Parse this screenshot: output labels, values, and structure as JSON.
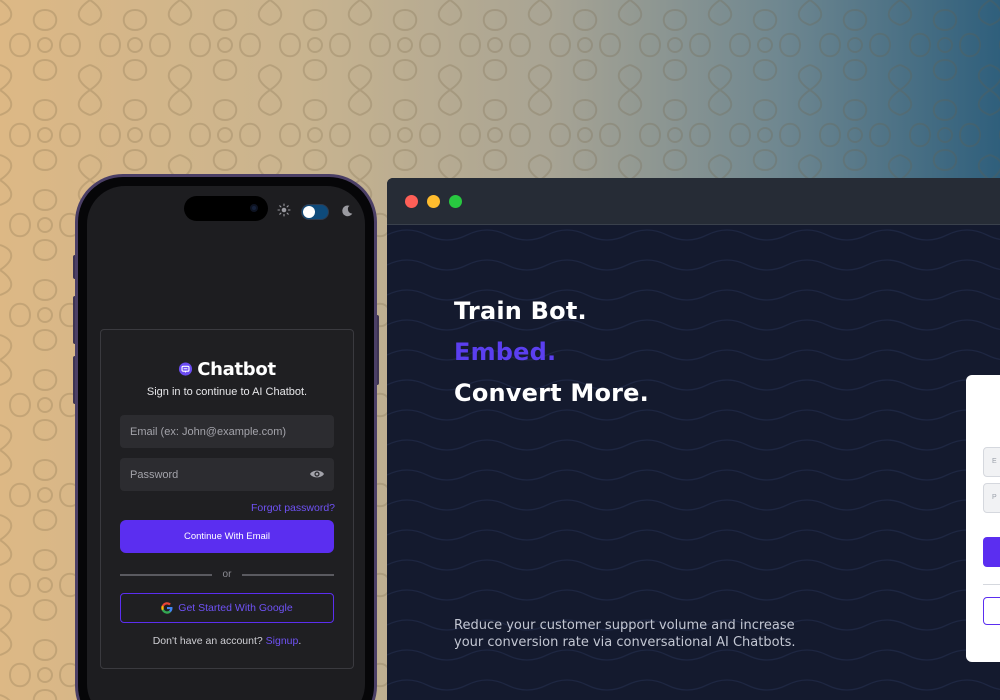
{
  "browser": {
    "hero": {
      "line1": "Train Bot.",
      "line2": "Embed.",
      "line3": "Convert More."
    },
    "tagline": "Reduce your customer support volume and increase your conversion rate via conversational AI Chatbots."
  },
  "phone": {
    "theme_toggle": {
      "state": "light",
      "icons": [
        "sun-icon",
        "moon-icon"
      ]
    },
    "login": {
      "brand": "Chatbot",
      "subtitle": "Sign in to continue to AI Chatbot.",
      "email_placeholder": "Email (ex: John@example.com)",
      "password_placeholder": "Password",
      "forgot_password": "Forgot password?",
      "continue_button": "Continue With Email",
      "or_text": "or",
      "google_button": "Get Started With Google",
      "no_account_text": "Don't have an account?",
      "signup_link": "Signup",
      "signup_suffix": "."
    }
  },
  "colors": {
    "accent": "#5b2ef0",
    "hero_accent": "#5b3ff0",
    "browser_bg": "#141a2e",
    "phone_screen": "#1d1d20"
  }
}
